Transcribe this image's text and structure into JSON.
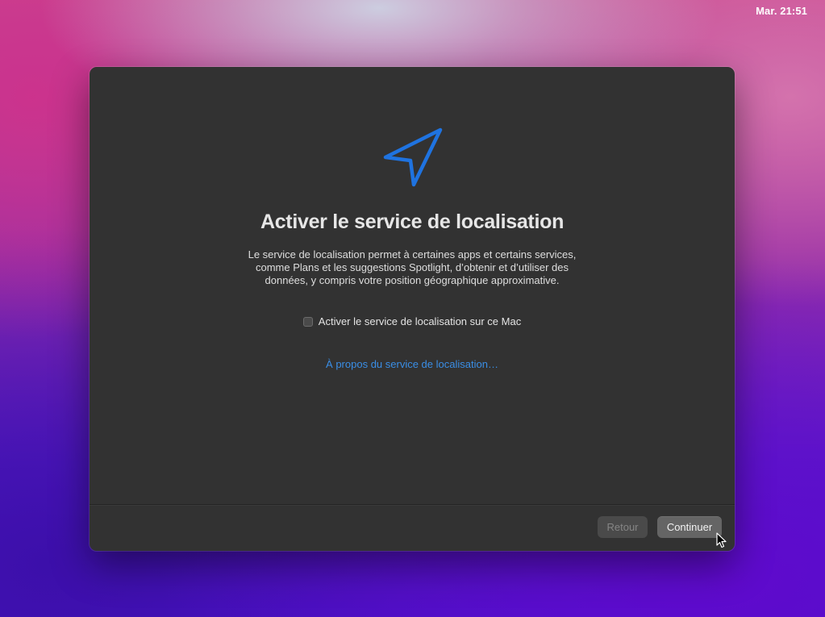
{
  "menubar": {
    "clock": "Mar. 21:51"
  },
  "dialog": {
    "icon": "location-arrow-icon",
    "icon_color": "#1f73e0",
    "title": "Activer le service de localisation",
    "description_lines": [
      "Le service de localisation permet à certaines apps et certains services,",
      "comme Plans et les suggestions Spotlight, d’obtenir et d’utiliser des",
      "données, y compris votre position géographique approximative."
    ],
    "checkbox": {
      "label": "Activer le service de localisation sur ce Mac",
      "checked": false
    },
    "link": "À propos du service de localisation…",
    "buttons": {
      "back": "Retour",
      "continue": "Continuer"
    }
  },
  "colors": {
    "window_background": "#323232",
    "link": "#3a8ee6"
  }
}
